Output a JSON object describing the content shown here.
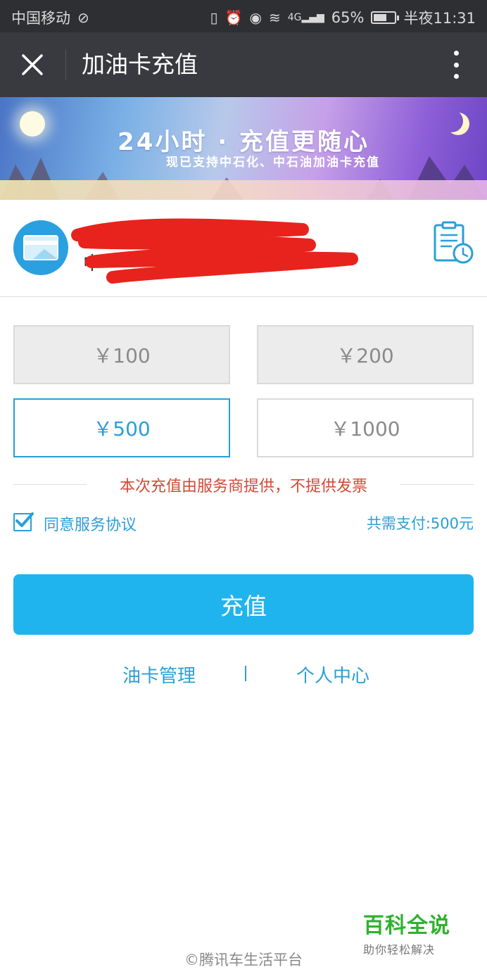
{
  "status_bar": {
    "carrier": "中国移动",
    "network": "4G",
    "battery_percent": "65%",
    "battery_level": 0.65,
    "time": "半夜11:31"
  },
  "header": {
    "title": "加油卡充值",
    "close_icon": "close-icon",
    "more_icon": "more-vertical-icon"
  },
  "banner": {
    "headline": "24小时 · 充值更随心",
    "subline": "现已支持中石化、中石油加油卡充值"
  },
  "card": {
    "number_line": "",
    "name_line": "中",
    "history_icon": "recharge-history-icon"
  },
  "amounts": {
    "a100": "￥100",
    "a200": "￥200",
    "a500": "￥500",
    "a1000": "￥1000",
    "selected": "￥500"
  },
  "notice": "本次充值由服务商提供，不提供发票",
  "agreement": {
    "label": "同意服务协议",
    "checked": true
  },
  "total": "共需支付:500元",
  "recharge_button": "充值",
  "links": {
    "card_manage": "油卡管理",
    "separator": "|",
    "user_center": "个人中心"
  },
  "watermark": {
    "main": "百科全说",
    "sub": "助你轻松解决"
  },
  "footer": "©腾讯车生活平台",
  "colors": {
    "accent": "#2a9fd6",
    "button": "#20b4ee",
    "notice": "#d24a34",
    "titlebar": "#393a3f"
  }
}
